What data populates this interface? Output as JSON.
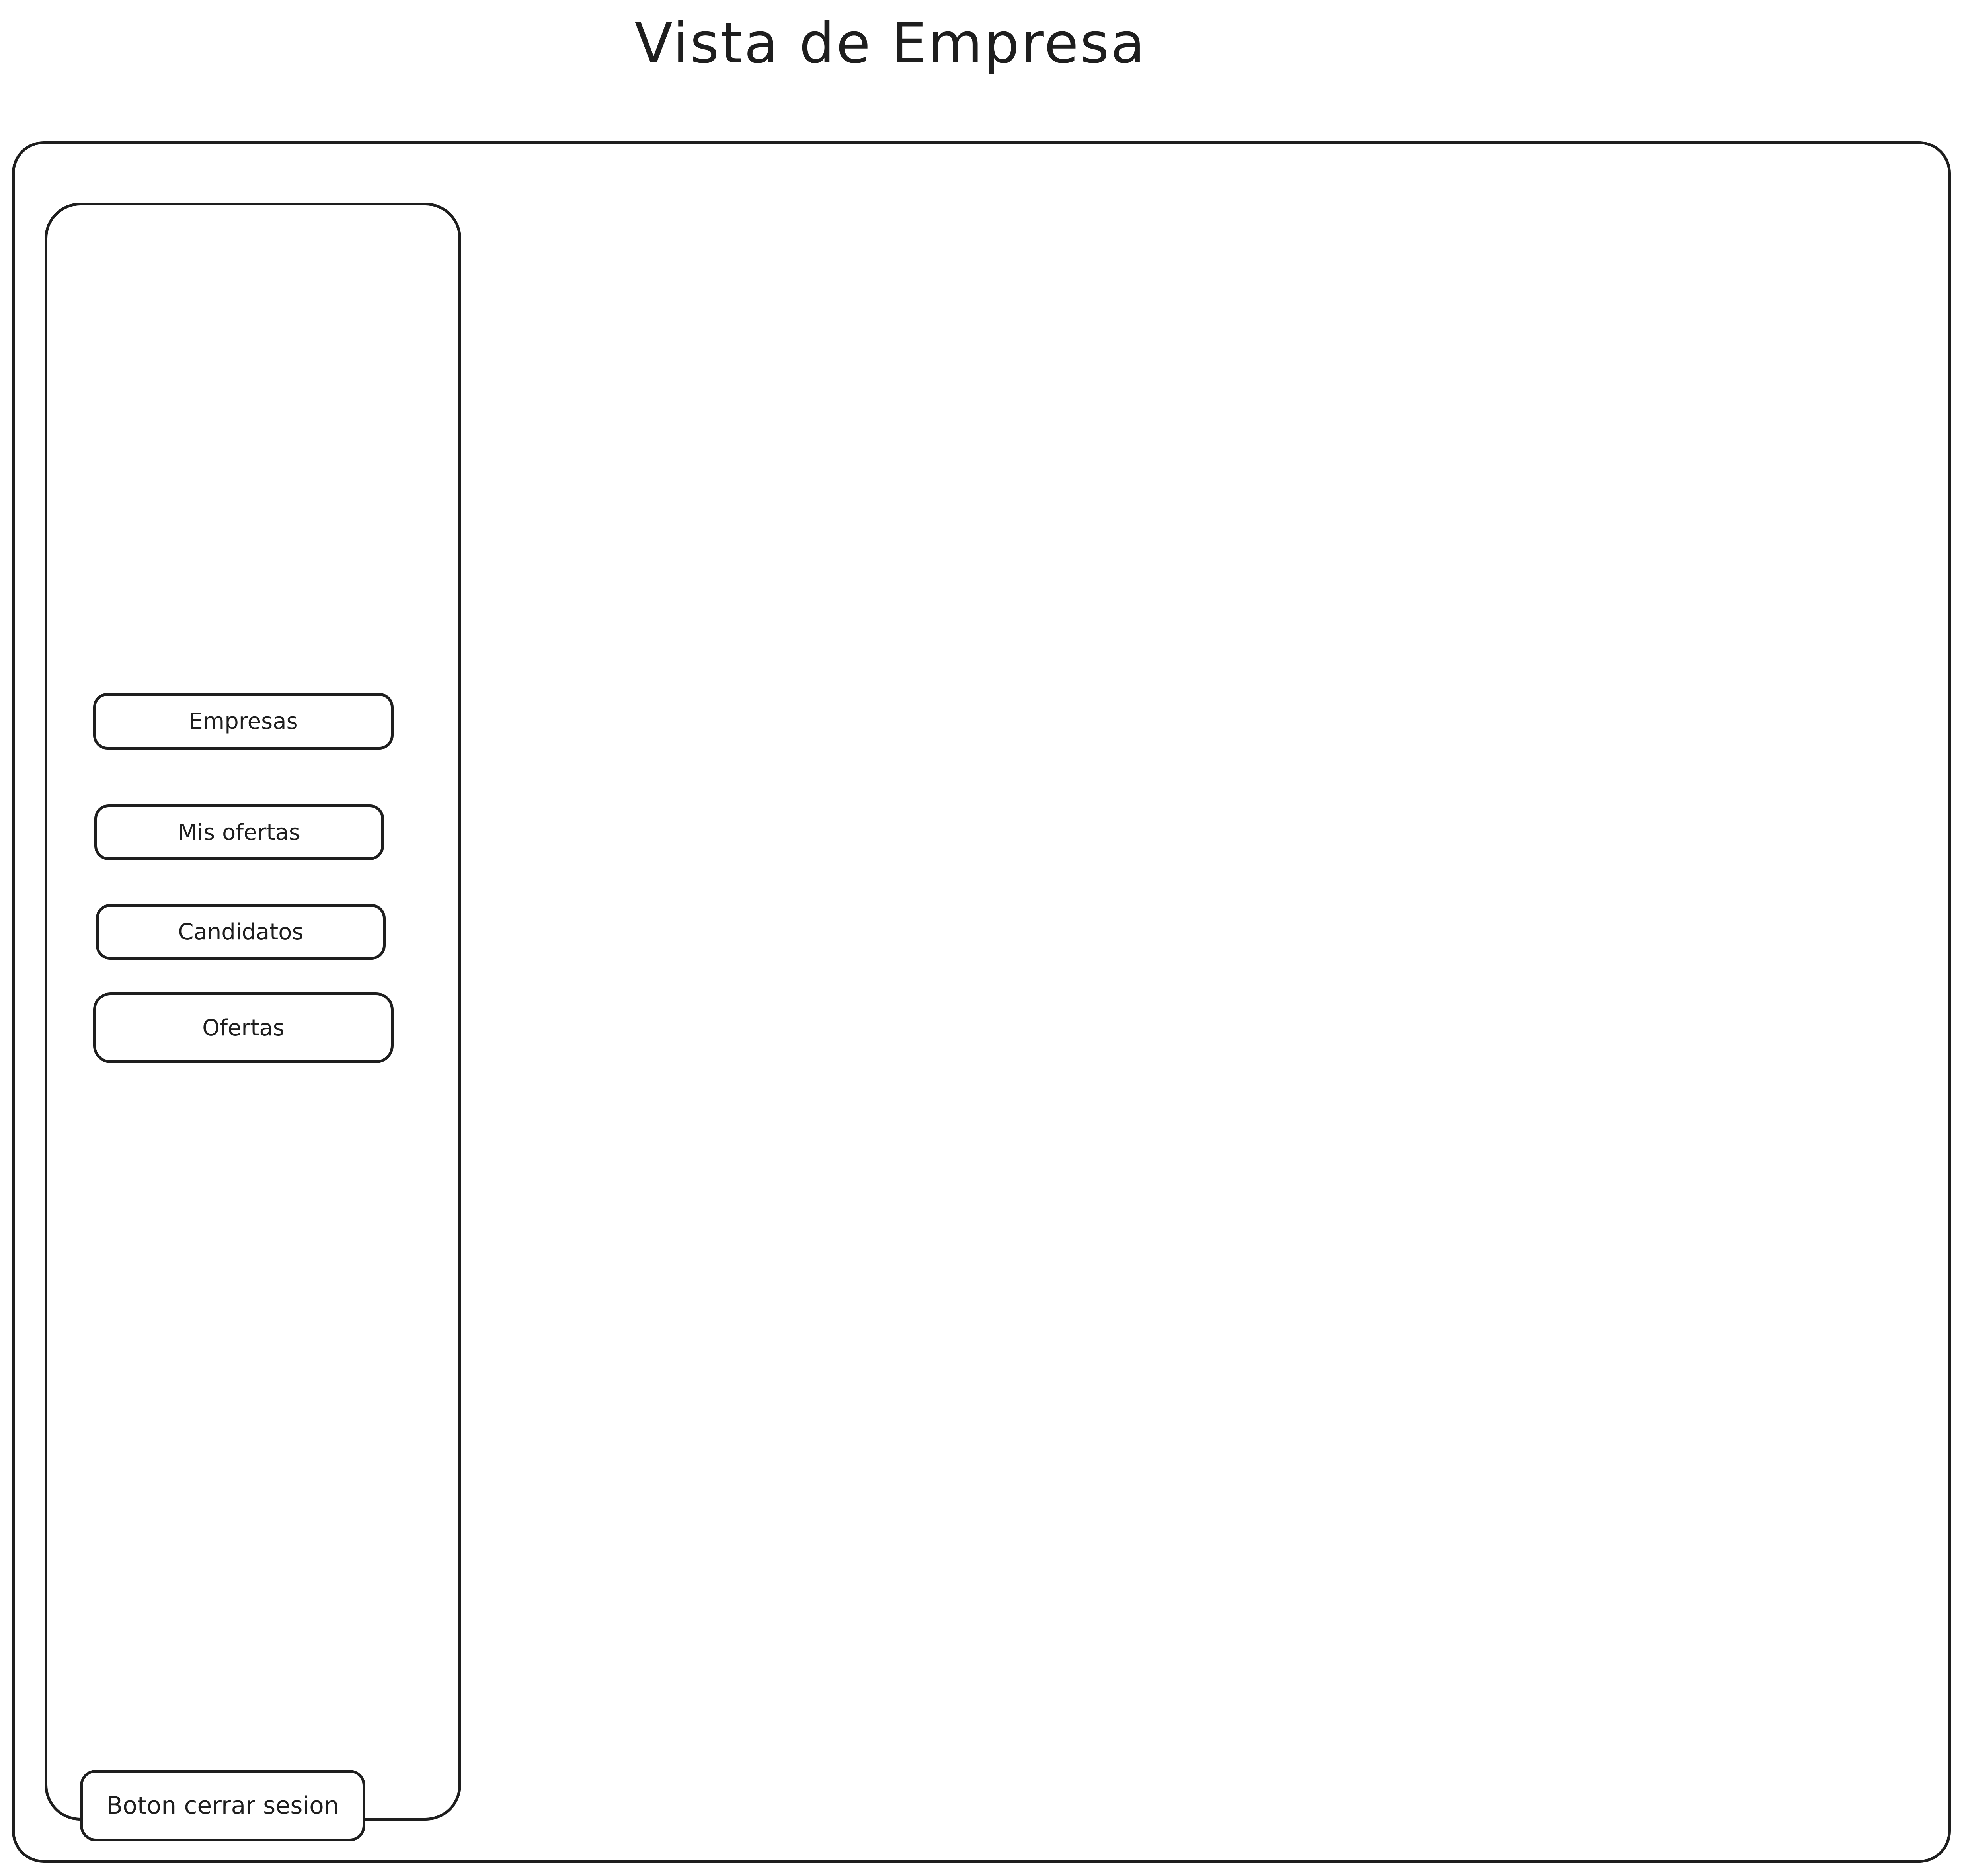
{
  "page": {
    "title": "Vista de Empresa"
  },
  "sidebar": {
    "items": [
      {
        "label": "Empresas"
      },
      {
        "label": "Mis ofertas"
      },
      {
        "label": "Candidatos"
      },
      {
        "label": "Ofertas"
      }
    ],
    "logout_label": "Boton cerrar sesion"
  },
  "colors": {
    "stroke": "#1e1e1e",
    "background": "#ffffff"
  }
}
